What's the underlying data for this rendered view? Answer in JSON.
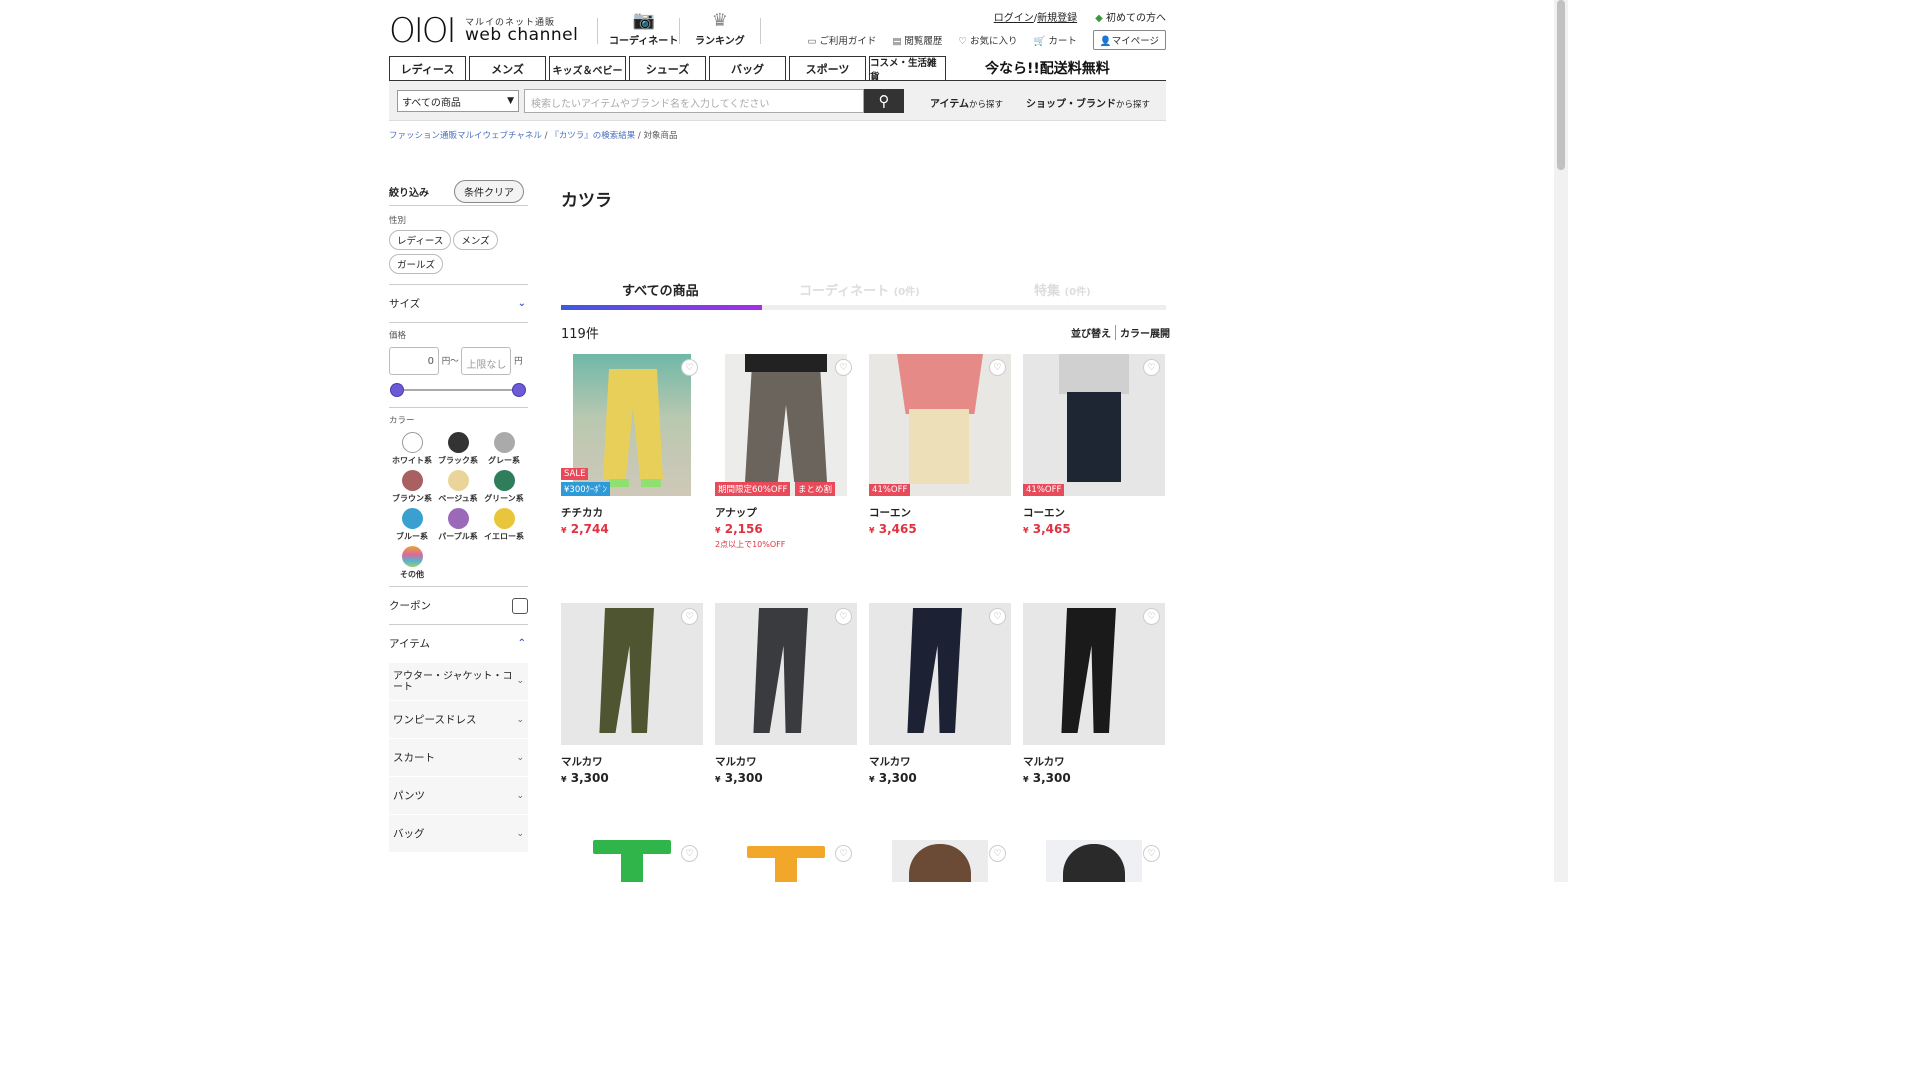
{
  "header": {
    "logo_main": "OIOI",
    "logo_sub": "マルイのネット通販",
    "logo_web": "web channel",
    "nav_coordinate": "コーディネート",
    "nav_ranking": "ランキング",
    "login": "ログイン",
    "register": "新規登録",
    "beginner": "初めての方へ",
    "guide": "ご利用ガイド",
    "history": "閲覧履歴",
    "favorites": "お気に入り",
    "cart": "カート",
    "mypage": "マイページ"
  },
  "categories": [
    "レディース",
    "メンズ",
    "キッズ＆ベビー",
    "シューズ",
    "バッグ",
    "スポーツ",
    "コスメ・生活雑貨"
  ],
  "promo": "今なら!!配送料無料",
  "search": {
    "scope": "すべての商品",
    "placeholder": "検索したいアイテムやブランド名を入力してください",
    "item_link": "アイテム",
    "item_suffix": "から探す",
    "shop_link": "ショップ・ブランド",
    "shop_suffix": "から探す"
  },
  "breadcrumb": {
    "home": "ファッション通販マルイウェブチャネル",
    "search": "『カツラ』の検索結果",
    "current": "対象商品",
    "sep": "/"
  },
  "sidebar": {
    "title": "絞り込み",
    "clear": "条件クリア",
    "gender_label": "性別",
    "genders": [
      "レディース",
      "メンズ",
      "ガールズ"
    ],
    "size": "サイズ",
    "price_label": "価格",
    "price_min": "0",
    "price_max_placeholder": "上限なし",
    "yen": "円",
    "tilde": "〜",
    "color_label": "カラー",
    "colors": [
      {
        "name": "ホワイト系",
        "hex": "#ffffff"
      },
      {
        "name": "ブラック系",
        "hex": "#333333"
      },
      {
        "name": "グレー系",
        "hex": "#aaaaaa"
      },
      {
        "name": "ブラウン系",
        "hex": "#a86060"
      },
      {
        "name": "ベージュ系",
        "hex": "#ead49a"
      },
      {
        "name": "グリーン系",
        "hex": "#2f7d5b"
      },
      {
        "name": "ブルー系",
        "hex": "#3aa0d0"
      },
      {
        "name": "パープル系",
        "hex": "#9a6ab8"
      },
      {
        "name": "イエロー系",
        "hex": "#e8c53a"
      },
      {
        "name": "その他",
        "hex": "multi"
      }
    ],
    "coupon": "クーポン",
    "item": "アイテム",
    "item_children": [
      "アウター・ジャケット・コート",
      "ワンピースドレス",
      "スカート",
      "パンツ",
      "バッグ"
    ]
  },
  "main": {
    "title": "カツラ",
    "tabs": [
      {
        "label": "すべての商品",
        "count": ""
      },
      {
        "label": "コーディネート",
        "count": "(0件)"
      },
      {
        "label": "特集",
        "count": "(0件)"
      }
    ],
    "result_count": "119件",
    "sort": "並び替え",
    "color_expand": "カラー展開"
  },
  "products": [
    {
      "brand": "チチカカ",
      "price": "2,744",
      "sale": true,
      "badges": [
        "SALE",
        "¥300ｸｰﾎﾟﾝ"
      ],
      "note": ""
    },
    {
      "brand": "アナップ",
      "price": "2,156",
      "sale": true,
      "badges": [
        "期間限定60%OFF",
        "まとめ割"
      ],
      "note": "2点以上で10%OFF"
    },
    {
      "brand": "コーエン",
      "price": "3,465",
      "sale": true,
      "badges": [
        "41%OFF"
      ],
      "note": ""
    },
    {
      "brand": "コーエン",
      "price": "3,465",
      "sale": true,
      "badges": [
        "41%OFF"
      ],
      "note": ""
    },
    {
      "brand": "マルカワ",
      "price": "3,300",
      "sale": false,
      "badges": [],
      "note": ""
    },
    {
      "brand": "マルカワ",
      "price": "3,300",
      "sale": false,
      "badges": [],
      "note": ""
    },
    {
      "brand": "マルカワ",
      "price": "3,300",
      "sale": false,
      "badges": [],
      "note": ""
    },
    {
      "brand": "マルカワ",
      "price": "3,300",
      "sale": false,
      "badges": [],
      "note": ""
    }
  ],
  "currency": "¥"
}
